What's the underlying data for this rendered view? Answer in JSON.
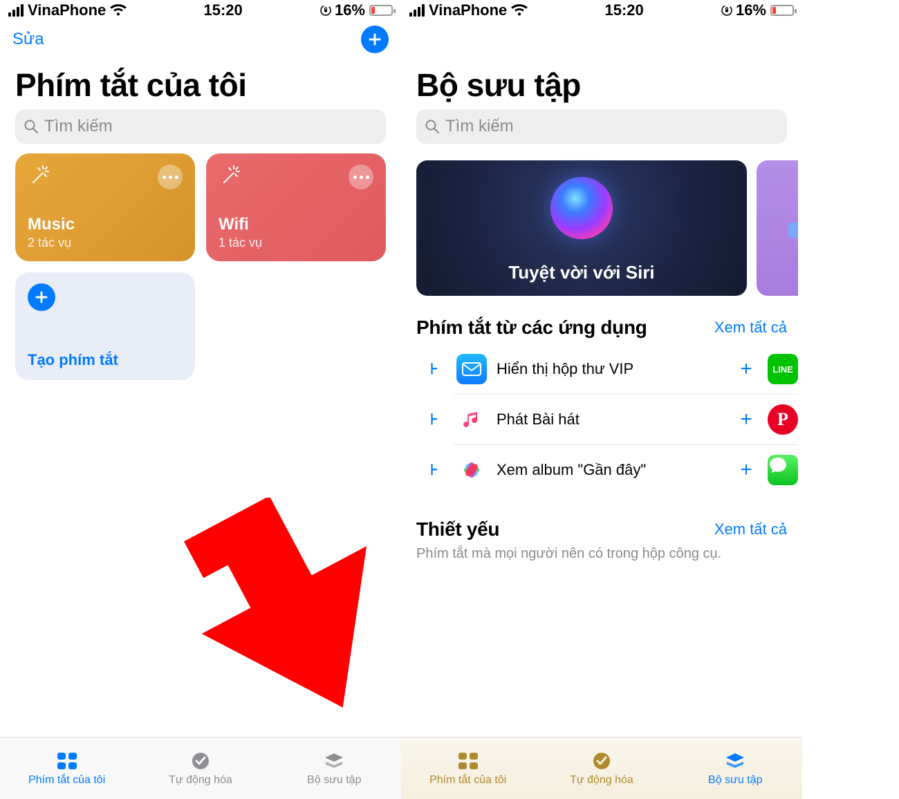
{
  "status": {
    "carrier": "VinaPhone",
    "time": "15:20",
    "battery_text": "16%",
    "battery_level_pct": 16
  },
  "left": {
    "nav_edit": "Sửa",
    "title": "Phím tắt của tôi",
    "search_placeholder": "Tìm kiếm",
    "cards": {
      "music": {
        "title": "Music",
        "subtitle": "2 tác vụ"
      },
      "wifi": {
        "title": "Wifi",
        "subtitle": "1 tác vụ"
      },
      "create": {
        "title": "Tạo phím tắt"
      }
    },
    "tabs": {
      "my": "Phím tắt của tôi",
      "auto": "Tự động hóa",
      "gallery": "Bộ sưu tập",
      "active_index": 0
    }
  },
  "right": {
    "title": "Bộ sưu tập",
    "search_placeholder": "Tìm kiếm",
    "hero_title": "Tuyệt vời với Siri",
    "section_apps": {
      "title": "Phím tắt từ các ứng dụng",
      "see_all": "Xem tất cả",
      "rows": [
        {
          "label": "Hiển thị hộp thư VIP",
          "app": "mail",
          "side": "line"
        },
        {
          "label": "Phát Bài hát",
          "app": "music",
          "side": "pinterest"
        },
        {
          "label": "Xem album \"Gần đây\"",
          "app": "photos",
          "side": "imessage"
        }
      ]
    },
    "section_essential": {
      "title": "Thiết yếu",
      "see_all": "Xem tất cả",
      "subtitle": "Phím tắt mà mọi người nên có trong hộp công cụ."
    },
    "tabs": {
      "my": "Phím tắt của tôi",
      "auto": "Tự động hóa",
      "gallery": "Bộ sưu tập",
      "active_index": 2
    }
  }
}
